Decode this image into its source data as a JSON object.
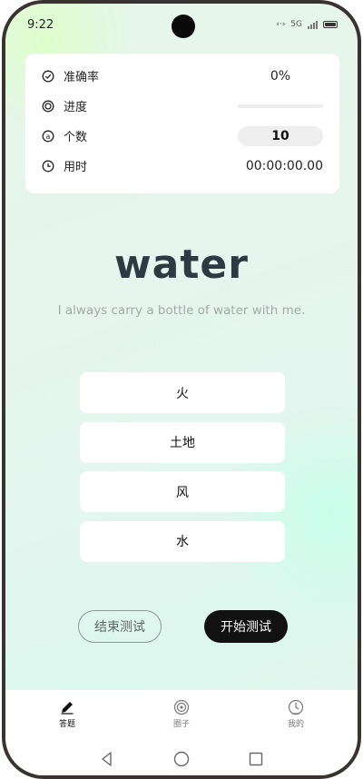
{
  "status_bar": {
    "time": "9:22",
    "network_label": "5G"
  },
  "stats": {
    "accuracy": {
      "label": "准确率",
      "value": "0%"
    },
    "progress": {
      "label": "进度",
      "percent": 0
    },
    "count": {
      "label": "个数",
      "value": "10"
    },
    "elapsed": {
      "label": "用时",
      "value": "00:00:00.00"
    }
  },
  "quiz": {
    "word": "water",
    "sentence": "I always carry a bottle of water with me.",
    "options": [
      "火",
      "土地",
      "风",
      "水"
    ]
  },
  "actions": {
    "end_label": "结束测试",
    "start_label": "开始测试"
  },
  "tabs": [
    {
      "label": "答题",
      "icon": "pencil-icon",
      "active": true
    },
    {
      "label": "圈子",
      "icon": "target-icon",
      "active": false
    },
    {
      "label": "我的",
      "icon": "profile-icon",
      "active": false
    }
  ],
  "colors": {
    "accent_dark": "#111111",
    "word_color": "#2d3a42",
    "sentence_color": "#a2aaa8"
  }
}
